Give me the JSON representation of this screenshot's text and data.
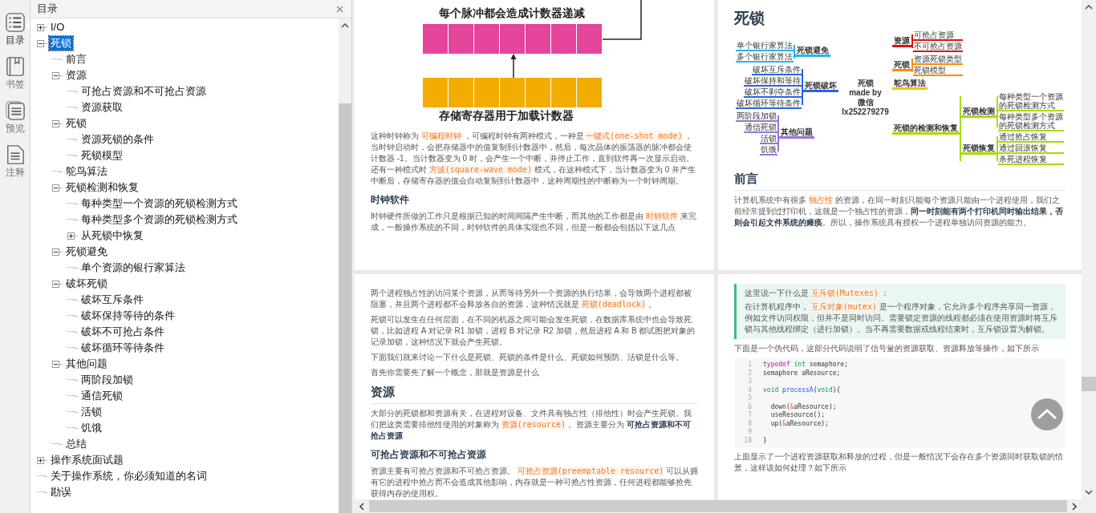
{
  "rail_tabs": [
    {
      "label": "目录",
      "kind": "toc",
      "selected": true
    },
    {
      "label": "书签",
      "kind": "bookmark",
      "selected": false
    },
    {
      "label": "预览",
      "kind": "preview",
      "selected": false
    },
    {
      "label": "注释",
      "kind": "notes",
      "selected": false
    }
  ],
  "toc": {
    "title": "目录",
    "items": [
      {
        "label": "I/O",
        "kind": "folder",
        "expanded": false,
        "selected": false
      },
      {
        "label": "死锁",
        "kind": "folder",
        "expanded": true,
        "selected": true,
        "children": [
          {
            "label": "前言",
            "kind": "leaf",
            "selected": false
          },
          {
            "label": "资源",
            "kind": "folder",
            "expanded": true,
            "selected": false,
            "children": [
              {
                "label": "可抢占资源和不可抢占资源",
                "kind": "leaf",
                "selected": false
              },
              {
                "label": "资源获取",
                "kind": "leaf",
                "selected": false
              }
            ]
          },
          {
            "label": "死锁",
            "kind": "folder",
            "expanded": true,
            "selected": false,
            "children": [
              {
                "label": "资源死锁的条件",
                "kind": "leaf",
                "selected": false
              },
              {
                "label": "死锁模型",
                "kind": "leaf",
                "selected": false
              }
            ]
          },
          {
            "label": "鸵鸟算法",
            "kind": "leaf",
            "selected": false
          },
          {
            "label": "死锁检测和恢复",
            "kind": "folder",
            "expanded": true,
            "selected": false,
            "children": [
              {
                "label": "每种类型一个资源的死锁检测方式",
                "kind": "leaf",
                "selected": false
              },
              {
                "label": "每种类型多个资源的死锁检测方式",
                "kind": "leaf",
                "selected": false
              },
              {
                "label": "从死锁中恢复",
                "kind": "folder",
                "expanded": false,
                "selected": false
              }
            ]
          },
          {
            "label": "死锁避免",
            "kind": "folder",
            "expanded": true,
            "selected": false,
            "children": [
              {
                "label": "单个资源的银行家算法",
                "kind": "leaf",
                "selected": false
              }
            ]
          },
          {
            "label": "破坏死锁",
            "kind": "folder",
            "expanded": true,
            "selected": false,
            "children": [
              {
                "label": "破坏互斥条件",
                "kind": "leaf",
                "selected": false
              },
              {
                "label": "破坏保持等待的条件",
                "kind": "leaf",
                "selected": false
              },
              {
                "label": "破坏不可抢占条件",
                "kind": "leaf",
                "selected": false
              },
              {
                "label": "破坏循环等待条件",
                "kind": "leaf",
                "selected": false
              }
            ]
          },
          {
            "label": "其他问题",
            "kind": "folder",
            "expanded": true,
            "selected": false,
            "children": [
              {
                "label": "两阶段加锁",
                "kind": "leaf",
                "selected": false
              },
              {
                "label": "通信死锁",
                "kind": "leaf",
                "selected": false
              },
              {
                "label": "活锁",
                "kind": "leaf",
                "selected": false
              },
              {
                "label": "饥饿",
                "kind": "leaf",
                "selected": false
              }
            ]
          },
          {
            "label": "总结",
            "kind": "leaf",
            "selected": false
          }
        ]
      },
      {
        "label": "操作系统面试题",
        "kind": "folder",
        "expanded": false,
        "selected": false
      },
      {
        "label": "关于操作系统，你必须知道的名词",
        "kind": "leaf",
        "selected": false
      },
      {
        "label": "勘误",
        "kind": "leaf",
        "selected": false
      }
    ]
  },
  "pages": [
    {
      "blocks": [
        {
          "kind": "register_figure",
          "top_caption": "每个脉冲都会造成计数器递减",
          "bottom_caption": "存储寄存器用于加载计数器"
        },
        {
          "kind": "paragraph",
          "parts": [
            {
              "kind": "text",
              "text": "这种时钟称为 "
            },
            {
              "kind": "code",
              "text": "可编程时钟"
            },
            {
              "kind": "text",
              "text": " ，可编程时钟有两种模式，一种是 "
            },
            {
              "kind": "code",
              "text": "一键式(one-shot mode)"
            },
            {
              "kind": "text",
              "text": " ，当时钟启动时，会把存储器中的值复制到计数器中，然后，每次晶体的振荡器的脉冲都会使计数器 -1。当计数器变为 0 时，会产生一个中断，并停止工作，直到软件再一次显示启动。还有一种模式时 "
            },
            {
              "kind": "code",
              "text": "方波(square-wave mode)"
            },
            {
              "kind": "text",
              "text": " 模式，在这种模式下，当计数器变为 0 并产生中断后，存储寄存器的值会自动复制到计数器中，这种周期性的中断称为一个时钟周期。"
            }
          ]
        },
        {
          "kind": "h3",
          "text": "时钟软件"
        },
        {
          "kind": "paragraph",
          "parts": [
            {
              "kind": "text",
              "text": "时钟硬件所做的工作只是根据已知的时间间隔产生中断，而其他的工作都是由 "
            },
            {
              "kind": "code",
              "text": "时钟软件"
            },
            {
              "kind": "text",
              "text": " 来完成，一般操作系统的不同，时钟软件的具体实现也不同，但是一般都会包括以下这几点"
            }
          ]
        }
      ]
    },
    {
      "blocks": [
        {
          "kind": "h1",
          "text": "死锁"
        },
        {
          "kind": "mindmap",
          "center": [
            "死锁",
            "made by",
            "微信",
            "lx252279279"
          ],
          "left": [
            {
              "label": "死锁避免",
              "color": "#22b5f0",
              "children": [
                {
                  "label": "单个银行家算法"
                },
                {
                  "label": "多个银行家算法"
                }
              ]
            },
            {
              "label": "死锁破坏",
              "color": "#2a62ea",
              "children": [
                {
                  "label": "破坏互斥条件"
                },
                {
                  "label": "破坏保持和等待"
                },
                {
                  "label": "破坏不剥夺条件"
                },
                {
                  "label": "破坏循环等待条件"
                }
              ]
            },
            {
              "label": "其他问题",
              "color": "#9a73d6",
              "children": [
                {
                  "label": "两阶段加锁"
                },
                {
                  "label": "通信死锁"
                },
                {
                  "label": "活锁"
                },
                {
                  "label": "饥饿"
                }
              ]
            }
          ],
          "right": [
            {
              "label": "资源",
              "color": "#d9140f",
              "children": [
                {
                  "label": "可抢占资源"
                },
                {
                  "label": "不可抢占资源"
                }
              ]
            },
            {
              "label": "死锁",
              "color": "#ff8a00",
              "children": [
                {
                  "label": "资源死锁类型"
                },
                {
                  "label": "死锁模型"
                }
              ]
            },
            {
              "label": "鸵鸟算法",
              "color": "#f2c500"
            },
            {
              "label": "死锁的检测和恢复",
              "color": "#a6dc00",
              "children": [
                {
                  "label": "死锁检测",
                  "children": [
                    {
                      "label": "每种类型一个资源的死锁检测方式"
                    },
                    {
                      "label": "每种类型多个资源的死锁检测方式"
                    }
                  ]
                },
                {
                  "label": "死锁恢复",
                  "children": [
                    {
                      "label": "通过抢占恢复"
                    },
                    {
                      "label": "通过回滚恢复"
                    },
                    {
                      "label": "杀死进程恢复"
                    }
                  ]
                }
              ]
            }
          ]
        },
        {
          "kind": "h2",
          "text": "前言"
        },
        {
          "kind": "paragraph",
          "parts": [
            {
              "kind": "text",
              "text": "计算机系统中有很多 "
            },
            {
              "kind": "code",
              "text": "独占性"
            },
            {
              "kind": "text",
              "text": " 的资源，在同一时刻只能每个资源只能由一个进程使用，我们之前经常提到过打印机，这就是一个独占性的资源，"
            },
            {
              "kind": "bold",
              "text": "同一时刻能有两个打印机同时输出结果，否则会引起文件系统的瘫痪"
            },
            {
              "kind": "text",
              "text": "。所以，操作系统具有授权一个进程单独访问资源的能力。"
            }
          ]
        }
      ]
    },
    {
      "blocks": [
        {
          "kind": "paragraph",
          "parts": [
            {
              "kind": "text",
              "text": "两个进程独占性的访问某个资源，从而等待另外一个资源的执行结果，会导致两个进程都被阻塞，并且两个进程都不会释放各自的资源，这种情况就是 "
            },
            {
              "kind": "code",
              "text": "死锁(deadlock)"
            },
            {
              "kind": "text",
              "text": " 。"
            }
          ]
        },
        {
          "kind": "paragraph",
          "parts": [
            {
              "kind": "text",
              "text": "死锁可以发生在任何层面，在不同的机器之间可能会发生死锁，在数据库系统中也会导致死锁，比如进程 A 对记录 R1 加锁，进程 B 对记录 R2 加锁，然后进程 A 和 B 都试图把对象的记录加锁，这种情况下就会产生死锁。"
            }
          ]
        },
        {
          "kind": "paragraph",
          "parts": [
            {
              "kind": "text",
              "text": "下面我们就来讨论一下什么是死锁、死锁的条件是什么、死锁如何预防、活锁是什么等。"
            }
          ]
        },
        {
          "kind": "paragraph",
          "parts": [
            {
              "kind": "text",
              "text": "首先你需要先了解一个概念，那就是资源是什么"
            }
          ]
        },
        {
          "kind": "h2",
          "text": "资源"
        },
        {
          "kind": "paragraph",
          "parts": [
            {
              "kind": "text",
              "text": "大部分的死锁都和资源有关，在进程对设备、文件具有独占性（排他性）时会产生死锁。我们把这类需要排他性使用的对象称为 "
            },
            {
              "kind": "code",
              "text": "资源(resource)"
            },
            {
              "kind": "text",
              "text": " 。资源主要分为 "
            },
            {
              "kind": "bold",
              "text": "可抢占资源和不可抢占资源"
            }
          ]
        },
        {
          "kind": "h3",
          "text": "可抢占资源和不可抢占资源"
        },
        {
          "kind": "paragraph",
          "parts": [
            {
              "kind": "text",
              "text": "资源主要有可抢占资源和不可抢占资源。 "
            },
            {
              "kind": "code",
              "text": "可抢占资源(preemptable resource)"
            },
            {
              "kind": "text",
              "text": " 可以从拥有它的进程中抢占而不会造成其他影响，内存就是一种可抢占性资源，任何进程都能够抢先获得内存的使用权。"
            }
          ]
        }
      ]
    },
    {
      "blocks": [
        {
          "kind": "quote",
          "paragraphs": [
            [
              {
                "kind": "text",
                "text": "这里说一下什么是 "
              },
              {
                "kind": "code",
                "text": "互斥锁(Mutexes)"
              },
              {
                "kind": "text",
                "text": " ："
              }
            ],
            [
              {
                "kind": "text",
                "text": "在计算机程序中， "
              },
              {
                "kind": "code",
                "text": "互斥对象(mutex)"
              },
              {
                "kind": "text",
                "text": " 是一个程序对象，它允许多个程序共享同一资源，例如文件访问权限，但并不是同时访问。需要锁定资源的线程都必须在使用资源时将互斥锁与其他线程绑定（进行加锁）。当不再需要数据或线程结束时，互斥锁设置为解锁。"
              }
            ]
          ]
        },
        {
          "kind": "paragraph",
          "parts": [
            {
              "kind": "text",
              "text": "下面是一个伪代码，这部分代码说明了信号量的资源获取、资源释放等操作，如下所示"
            }
          ]
        },
        {
          "kind": "code",
          "lines": [
            {
              "number": "1",
              "tokens": [
                {
                  "kind": "kw",
                  "text": "typedef"
                },
                {
                  "kind": "type",
                  "text": " int"
                },
                {
                  "kind": "plain",
                  "text": " semaphore;"
                }
              ]
            },
            {
              "number": "2",
              "tokens": [
                {
                  "kind": "plain",
                  "text": "semaphore aResource;"
                }
              ]
            },
            {
              "number": "3"
            },
            {
              "number": "4",
              "tokens": [
                {
                  "kind": "type",
                  "text": "void"
                },
                {
                  "kind": "fn",
                  "text": " processA"
                },
                {
                  "kind": "plain",
                  "text": "("
                },
                {
                  "kind": "type",
                  "text": "void"
                },
                {
                  "kind": "plain",
                  "text": "){"
                }
              ]
            },
            {
              "number": "5"
            },
            {
              "number": "6",
              "tokens": [
                {
                  "kind": "plain",
                  "text": "  down("
                },
                {
                  "kind": "amp",
                  "text": "&"
                },
                {
                  "kind": "plain",
                  "text": "aResource);"
                }
              ]
            },
            {
              "number": "7",
              "tokens": [
                {
                  "kind": "plain",
                  "text": "  useResource();"
                }
              ]
            },
            {
              "number": "8",
              "tokens": [
                {
                  "kind": "plain",
                  "text": "  up("
                },
                {
                  "kind": "amp",
                  "text": "&"
                },
                {
                  "kind": "plain",
                  "text": "aResource);"
                }
              ]
            },
            {
              "number": "9"
            },
            {
              "number": "10",
              "tokens": [
                {
                  "kind": "plain",
                  "text": "}"
                }
              ]
            }
          ]
        },
        {
          "kind": "paragraph",
          "parts": [
            {
              "kind": "text",
              "text": "上面显示了一个进程资源获取和释放的过程，但是一般情况下会存在多个资源同时获取锁的情景，这样该如何处理？如下所示"
            }
          ]
        }
      ]
    }
  ]
}
